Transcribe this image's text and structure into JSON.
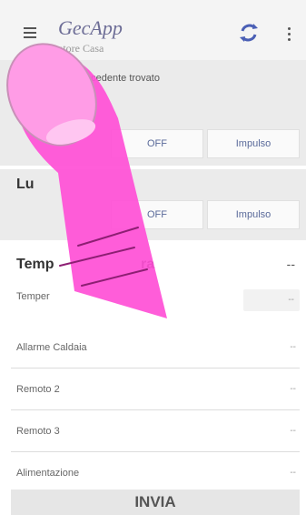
{
  "header": {
    "brand": "GecApp",
    "subtitle": "atore Casa",
    "menu_icon": "hamburger-menu-icon",
    "refresh_icon": "refresh-icon",
    "more_icon": "more-vert-icon",
    "accent_color": "#4a5fb5"
  },
  "section1": {
    "notice": "ecedente trovato",
    "buttons": [
      {
        "label": "OFF"
      },
      {
        "label": "Impulso"
      }
    ]
  },
  "section2": {
    "title": "Lu",
    "buttons": [
      {
        "label": "OFF"
      },
      {
        "label": "Impulso"
      }
    ]
  },
  "temperature": {
    "title_start": "Temp",
    "title_end": "ra",
    "title_value": "--",
    "row_label": "Temper",
    "row_value": "--"
  },
  "rows": [
    {
      "label": "Allarme Caldaia",
      "value": "--"
    },
    {
      "label": "Remoto 2",
      "value": "--"
    },
    {
      "label": "Remoto 3",
      "value": "--"
    },
    {
      "label": "Alimentazione",
      "value": "--"
    }
  ],
  "action": {
    "send_label": "INVIA"
  }
}
